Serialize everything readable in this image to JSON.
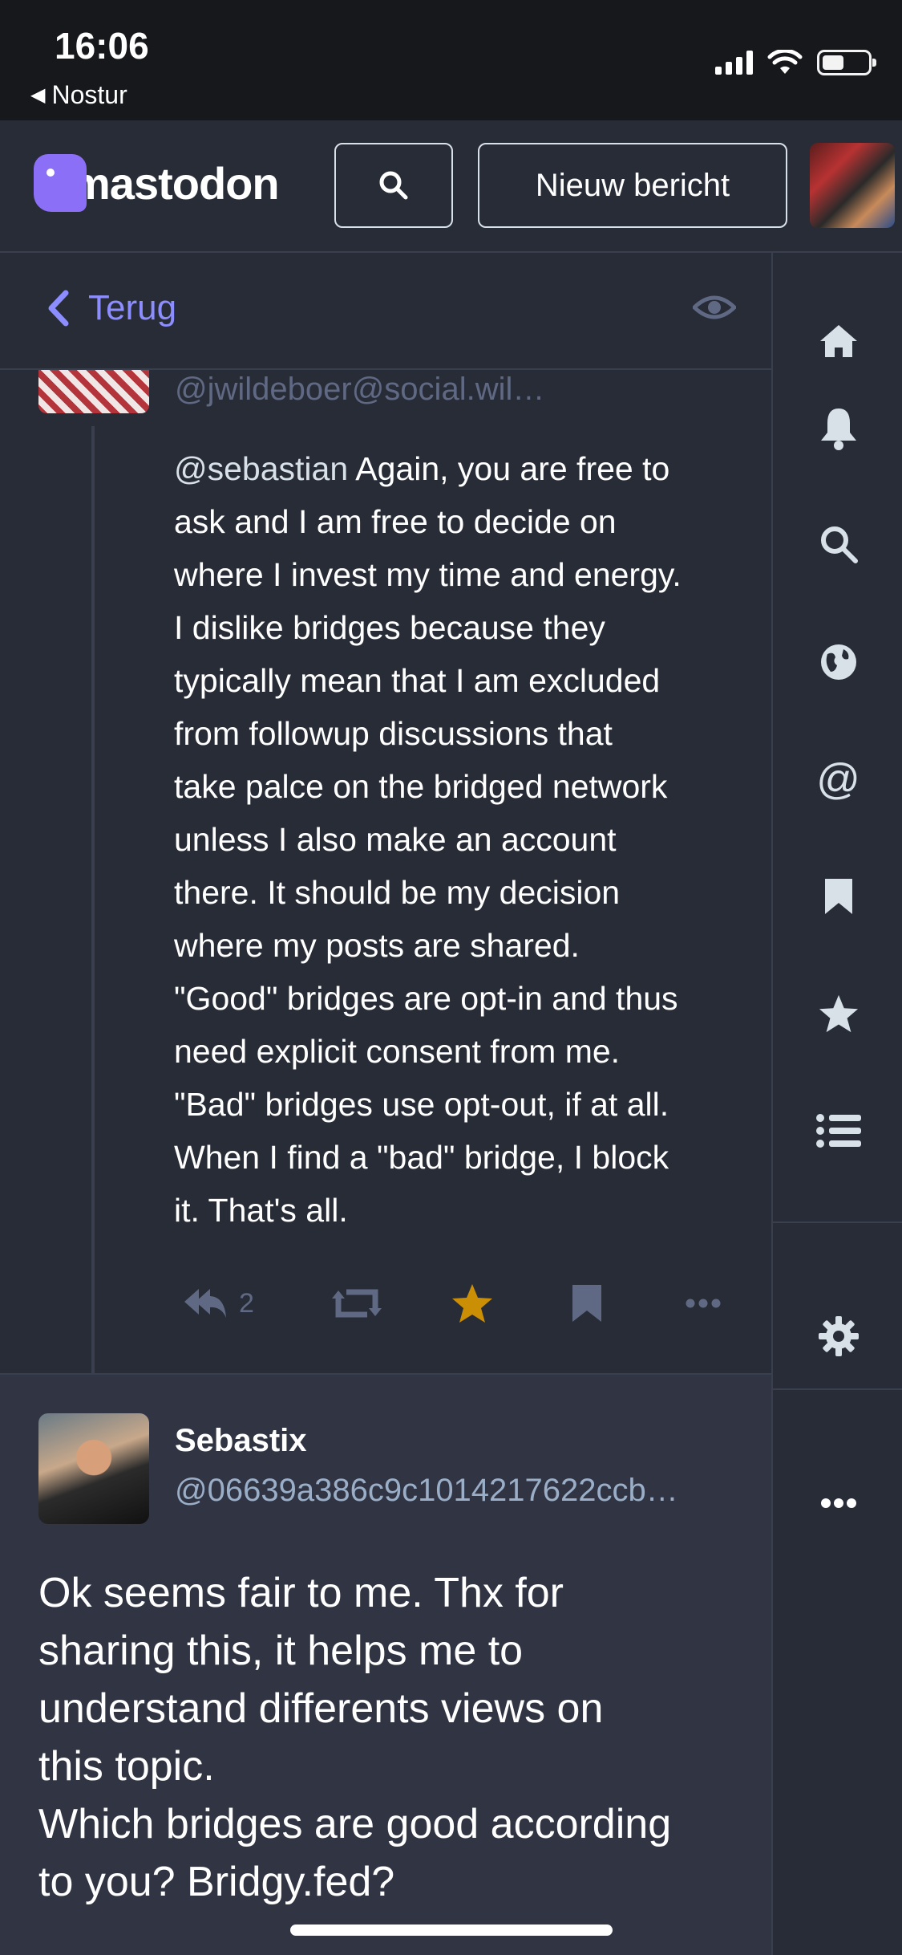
{
  "status_bar": {
    "time": "16:06",
    "back_app": "Nostur"
  },
  "header": {
    "logo_text": "mastodon",
    "new_post_label": "Nieuw bericht"
  },
  "column": {
    "back_label": "Terug"
  },
  "post1": {
    "handle": "@jwildeboer@social.wil…",
    "mention": "@sebastian",
    "content_lines": [
      " Again, you are free to",
      "ask and I am free to decide on",
      "where I invest my time and energy.",
      "I dislike bridges because they",
      "typically mean that I am excluded",
      "from followup discussions that",
      "take palce on the bridged network",
      "unless I also make an account",
      "there. It should be my decision",
      "where my posts are shared.",
      "\"Good\" bridges are  opt-in and thus",
      "need explicit consent from me.",
      "\"Bad\" bridges use opt-out, if at all.",
      "When I find a \"bad\" bridge, I block",
      "it. That's all."
    ],
    "reply_count": "2",
    "favourited": true,
    "star_color": "#ca8f04"
  },
  "post2": {
    "display_name": "Sebastix",
    "handle": "@06639a386c9c1014217622ccb…",
    "content_lines": [
      "Ok seems fair to me. Thx for",
      "sharing this, it helps me to",
      "understand differents views on",
      "this topic.",
      "Which bridges are good according",
      "to you? Bridgy.fed?"
    ]
  },
  "sidebar": {
    "items": [
      "home-icon",
      "bell-icon",
      "search-icon",
      "globe-icon",
      "at-icon",
      "bookmark-icon",
      "star-icon",
      "list-icon",
      "gear-icon",
      "more-icon"
    ]
  },
  "colors": {
    "accent": "#8c8dff",
    "background": "#282c37",
    "muted": "#606984"
  }
}
